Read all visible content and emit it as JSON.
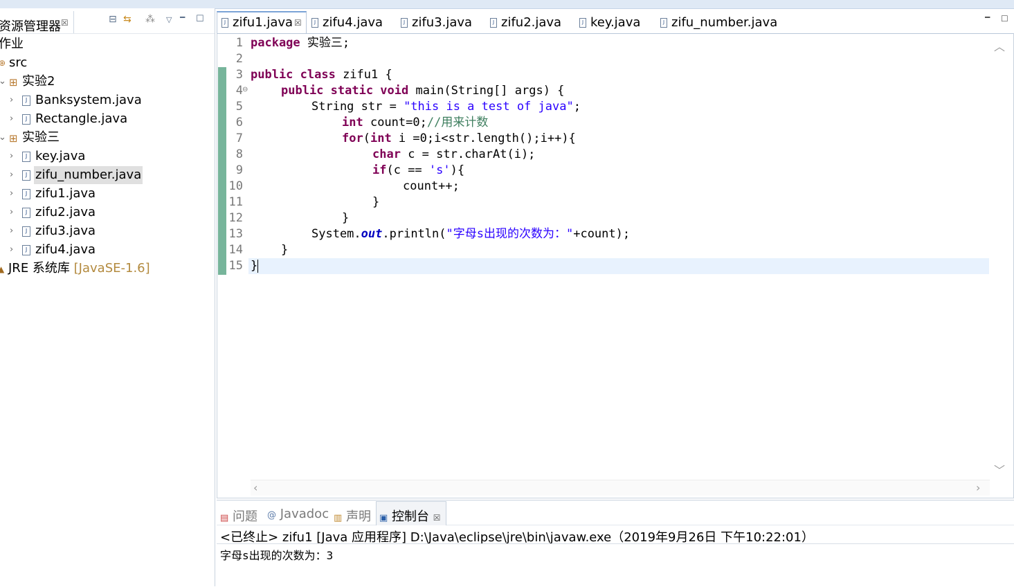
{
  "explorer": {
    "title": "资源管理器",
    "close_glyph": "☒",
    "project": "作业",
    "src": "src",
    "packages": [
      {
        "name": "实验2",
        "files": [
          "Banksystem.java",
          "Rectangle.java"
        ]
      },
      {
        "name": "实验三",
        "files": [
          "key.java",
          "zifu_number.java",
          "zifu1.java",
          "zifu2.java",
          "zifu3.java",
          "zifu4.java"
        ]
      }
    ],
    "selected_file": "zifu_number.java",
    "jre": {
      "label": "JRE 系统库",
      "suffix": "[JavaSE-1.6]"
    },
    "toolbar_icons": [
      "collapse-all-icon",
      "link-with-editor-icon",
      "filter-icon",
      "view-menu-icon",
      "minimize-icon",
      "maximize-icon"
    ]
  },
  "editor": {
    "tabs": [
      "zifu1.java",
      "zifu4.java",
      "zifu3.java",
      "zifu2.java",
      "key.java",
      "zifu_number.java"
    ],
    "active_tab": "zifu1.java",
    "line_numbers": [
      "1",
      "2",
      "3",
      "4",
      "5",
      "6",
      "7",
      "8",
      "9",
      "10",
      "11",
      "12",
      "13",
      "14",
      "15"
    ],
    "code": {
      "l1_kw": "package",
      "l1_rest": " 实验三;",
      "l3_kw": "public class",
      "l3_rest": " zifu1 {",
      "l4_kw": "public static void",
      "l4_rest": " main(String[] args) {",
      "l5_a": "String str = ",
      "l5_str": "\"this is a test of java\"",
      "l5_b": ";",
      "l6_kw": "int",
      "l6_rest": " count=0;",
      "l6_cm": "//用来计数",
      "l7_kw": "for",
      "l7_a": "(",
      "l7_kw2": "int",
      "l7_b": " i =0;i<str.length();i++){",
      "l8_kw": "char",
      "l8_rest": " c = str.charAt(i);",
      "l9_kw": "if",
      "l9_a": "(c == ",
      "l9_str": "'s'",
      "l9_b": "){",
      "l10": "count++;",
      "l11": "}",
      "l12": "}",
      "l13_a": "System.",
      "l13_fld": "out",
      "l13_b": ".println(",
      "l13_str": "\"字母s出现的次数为：\"",
      "l13_c": "+count);",
      "l14": "}",
      "l15": "}"
    }
  },
  "console": {
    "tabs": [
      "问题",
      "Javadoc",
      "声明",
      "控制台"
    ],
    "active_tab": "控制台",
    "status": "<已终止> zifu1 [Java 应用程序] D:\\Java\\eclipse\\jre\\bin\\javaw.exe（2019年9月26日 下午10:22:01）",
    "output": "字母s出现的次数为：3"
  },
  "colors": {
    "keyword": "#7f0055",
    "string": "#2a00ff",
    "comment": "#3f7f5f",
    "field": "#0000c0",
    "change_bar": "#5fa88a",
    "current_line": "#e8f2fe"
  }
}
